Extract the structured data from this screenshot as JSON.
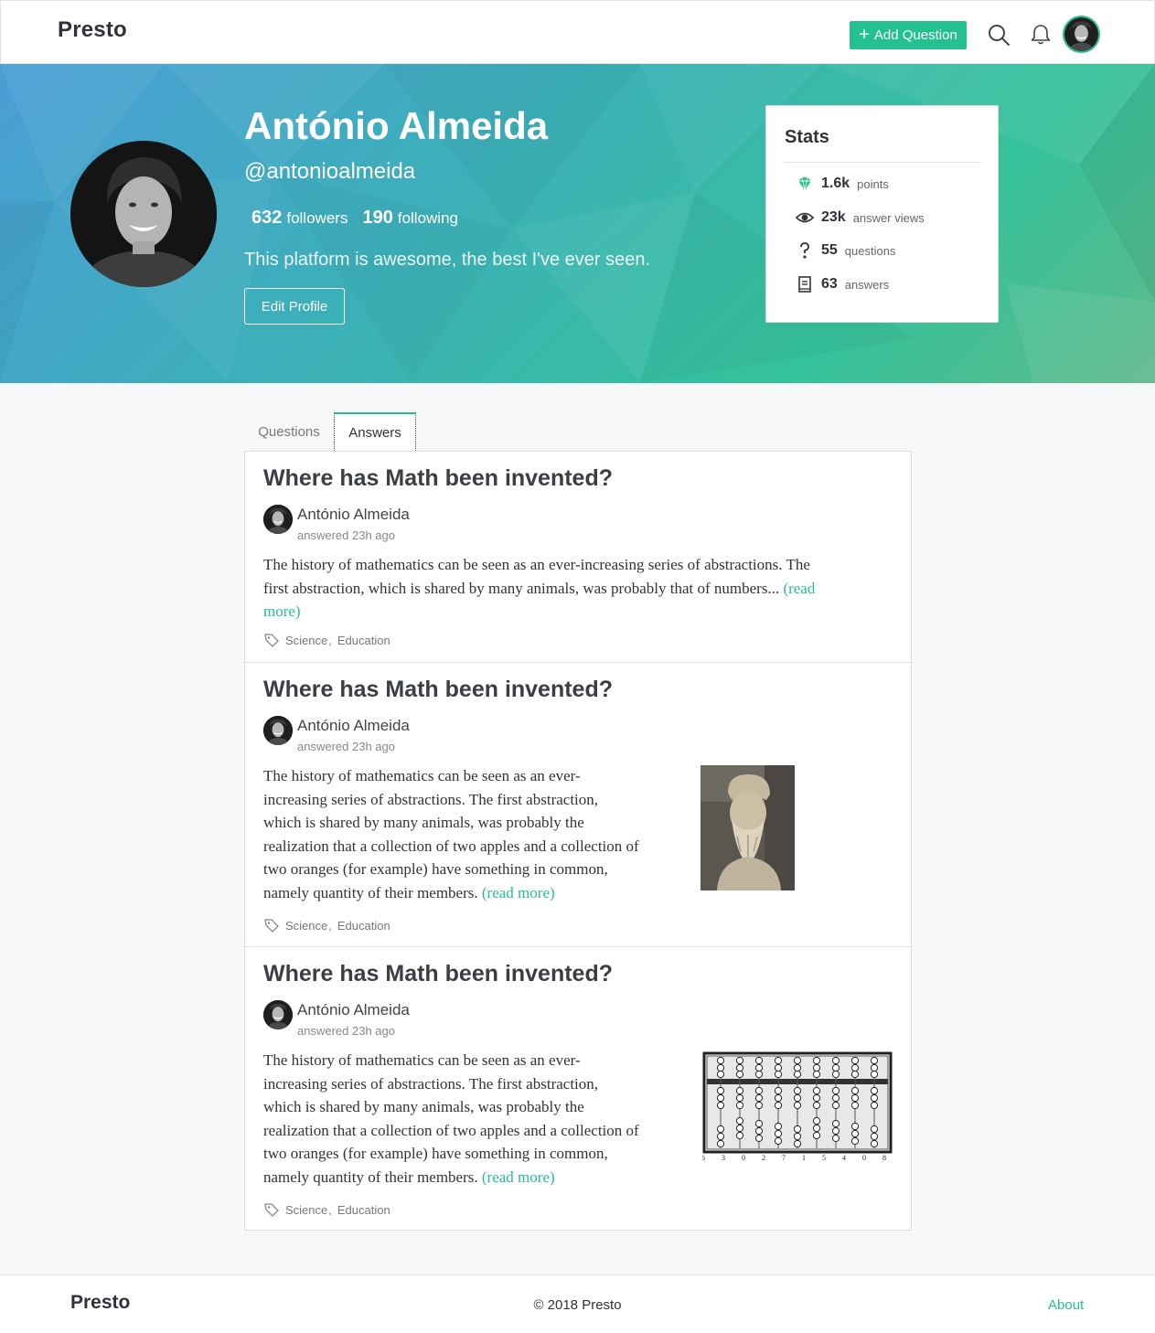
{
  "navbar": {
    "brand": "Presto",
    "add_question_label": "Add Question"
  },
  "profile": {
    "name": "António Almeida",
    "handle": "@antonioalmeida",
    "followers_count": "632",
    "followers_label": "followers",
    "following_count": "190",
    "following_label": "following",
    "bio": "This platform is awesome, the best I've ever seen.",
    "edit_label": "Edit Profile"
  },
  "stats": {
    "title": "Stats",
    "items": [
      {
        "value": "1.6k",
        "label": "points",
        "icon": "diamond-icon"
      },
      {
        "value": "23k",
        "label": "answer views",
        "icon": "eye-icon"
      },
      {
        "value": "55",
        "label": "questions",
        "icon": "question-icon"
      },
      {
        "value": "63",
        "label": "answers",
        "icon": "book-icon"
      }
    ]
  },
  "tabs": [
    "Questions",
    "Answers"
  ],
  "answers": [
    {
      "title": "Where has Math been invented?",
      "author": "António Almeida",
      "time": "answered 23h ago",
      "lines": [
        "The history of mathematics can be seen as an ever-increasing series of abstractions. The",
        "first abstraction, which is shared by many animals, was probably that of numbers..."
      ],
      "last_line": "",
      "read_more": "(read",
      "read_more_2": "more)",
      "tag1": "Science",
      "tag2": "Education"
    },
    {
      "title": "Where has Math been invented?",
      "author": "António Almeida",
      "time": "answered 23h ago",
      "lines": [
        "The history of mathematics can be seen as an ever-",
        "increasing series of abstractions. The first abstraction,",
        "which is shared by many animals, was probably the",
        "realization that a collection of two apples and a collection of",
        "two oranges (for example) have something in common,"
      ],
      "last_line": "namely quantity of their members.",
      "read_more": "(read more)",
      "tag1": "Science",
      "tag2": "Education"
    },
    {
      "title": "Where has Math been invented?",
      "author": "António Almeida",
      "time": "answered 23h ago",
      "lines": [
        "The history of mathematics can be seen as an ever-",
        "increasing series of abstractions. The first abstraction,",
        "which is shared by many animals, was probably the",
        "realization that a collection of two apples and a collection of",
        "two oranges (for example) have something in common,"
      ],
      "last_line": "namely quantity of their members.",
      "read_more": "(read more)",
      "tag1": "Science",
      "tag2": "Education",
      "abacus_digits": "6 3 0 2 7 1 5 4 0 8"
    }
  ],
  "footer": {
    "brand": "Presto",
    "copyright": "© 2018 Presto",
    "about": "About"
  },
  "colors": {
    "accent": "#25c08f",
    "text_dark": "#2f3337"
  }
}
